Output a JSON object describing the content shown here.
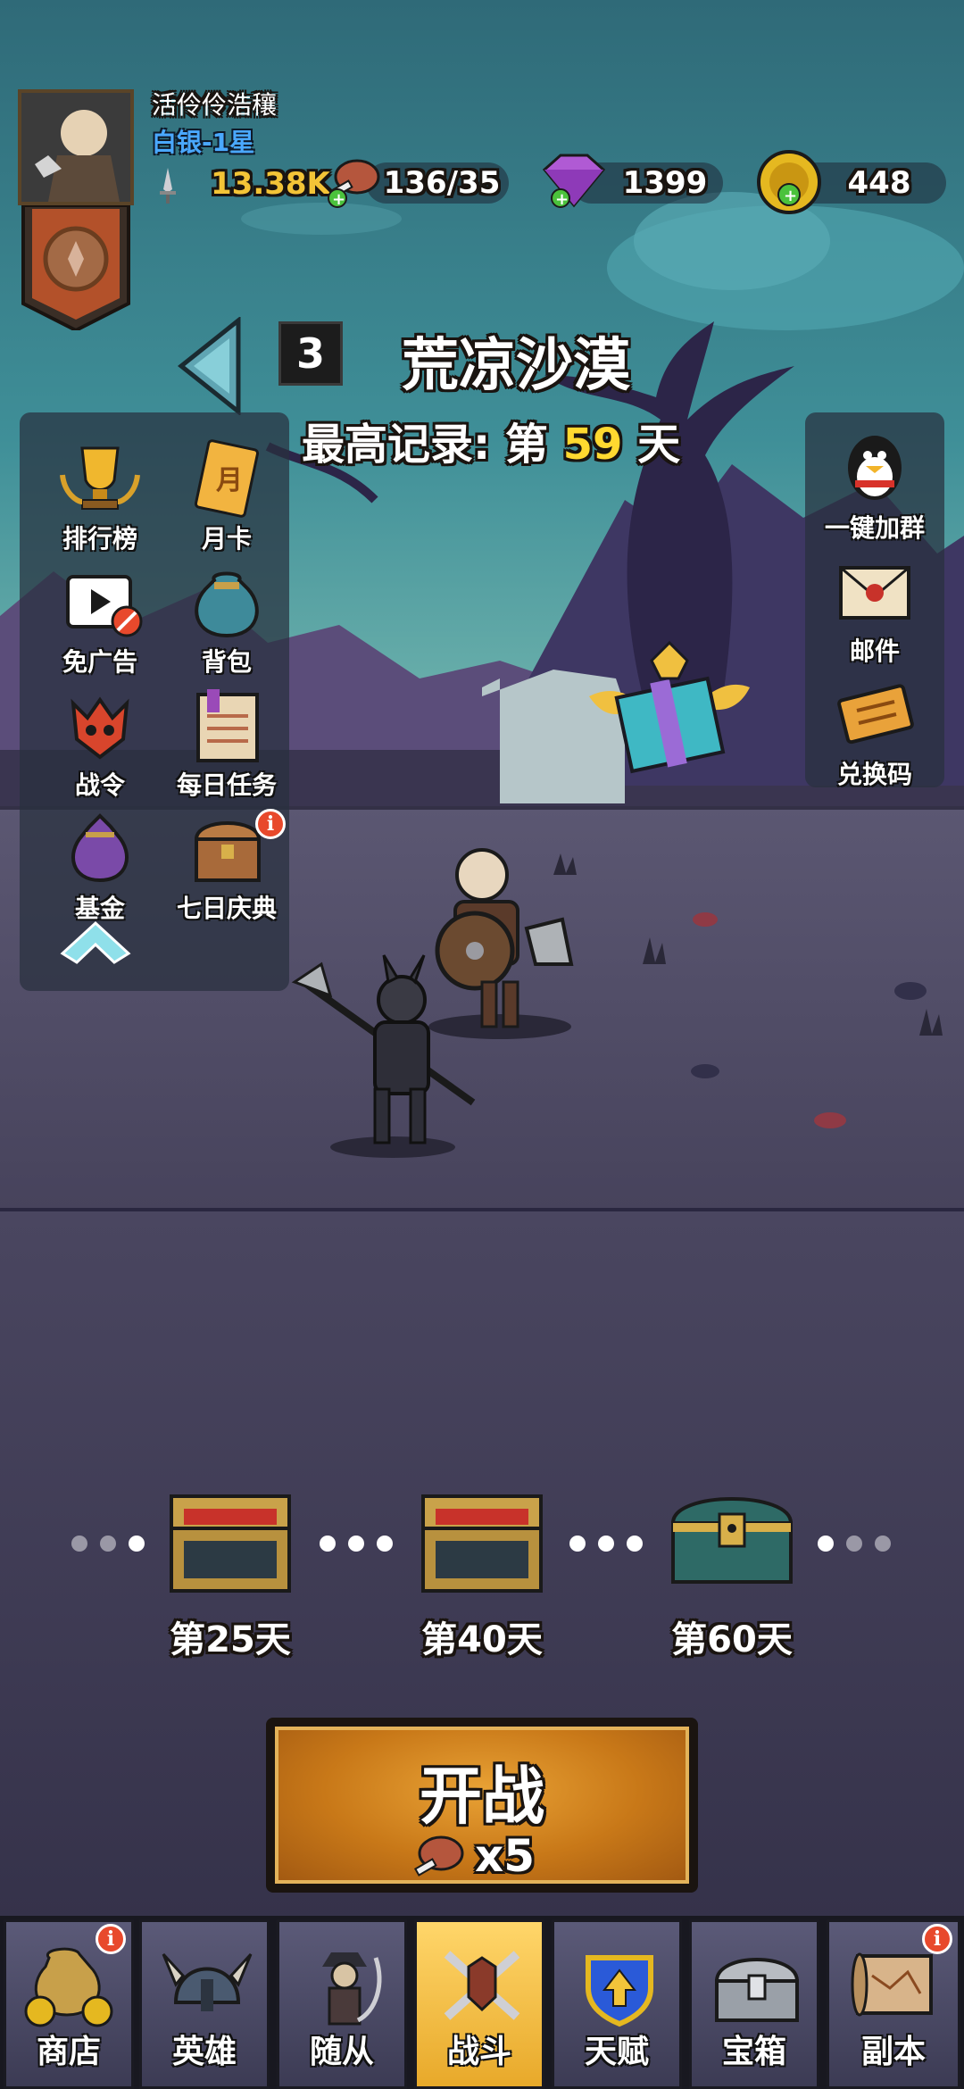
{
  "player": {
    "name": "活伶伶浩穰",
    "rank": "白银-1星"
  },
  "resources": {
    "power": "13.38K",
    "stamina": "136/35",
    "gems": "1399",
    "gold": "448"
  },
  "stage": {
    "number": "3",
    "title": "荒凉沙漠",
    "record_prefix": "最高记录: 第",
    "record_value": "59",
    "record_suffix": "天"
  },
  "left_menu": [
    {
      "label": "排行榜",
      "icon": "trophy-icon"
    },
    {
      "label": "月卡",
      "icon": "month-card-icon"
    },
    {
      "label": "免广告",
      "icon": "no-ads-icon"
    },
    {
      "label": "背包",
      "icon": "bag-icon"
    },
    {
      "label": "战令",
      "icon": "battle-pass-icon"
    },
    {
      "label": "每日任务",
      "icon": "daily-task-icon"
    },
    {
      "label": "基金",
      "icon": "fund-icon"
    },
    {
      "label": "七日庆典",
      "icon": "seven-day-icon"
    }
  ],
  "right_menu": [
    {
      "label": "一键加群",
      "icon": "qq-icon"
    },
    {
      "label": "邮件",
      "icon": "mail-icon"
    },
    {
      "label": "兑换码",
      "icon": "redeem-code-icon"
    }
  ],
  "milestones": [
    {
      "label": "第25天"
    },
    {
      "label": "第40天"
    },
    {
      "label": "第60天"
    }
  ],
  "battle": {
    "label": "开战",
    "cost": "x5"
  },
  "nav": [
    {
      "label": "商店"
    },
    {
      "label": "英雄"
    },
    {
      "label": "随从"
    },
    {
      "label": "战斗"
    },
    {
      "label": "天赋"
    },
    {
      "label": "宝箱"
    },
    {
      "label": "副本"
    }
  ],
  "info_badge": "i",
  "colors": {
    "accent_gold": "#ffd930",
    "rank_blue": "#4aa8ff",
    "active_tab": "#f2b83a",
    "notice_red": "#e8492c"
  }
}
